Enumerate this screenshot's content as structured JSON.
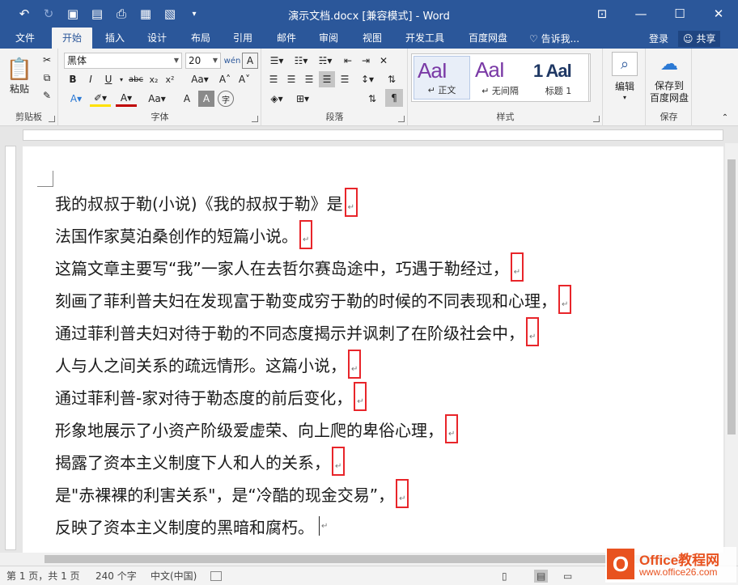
{
  "window": {
    "title": "演示文档.docx [兼容模式] - Word",
    "accent_color": "#2b579a"
  },
  "quick_access": {
    "undo_icon": "undo-icon",
    "redo_icon": "redo-icon",
    "save_icon": "save-icon"
  },
  "tabs": [
    {
      "label": "文件"
    },
    {
      "label": "开始"
    },
    {
      "label": "插入"
    },
    {
      "label": "设计"
    },
    {
      "label": "布局"
    },
    {
      "label": "引用"
    },
    {
      "label": "邮件"
    },
    {
      "label": "审阅"
    },
    {
      "label": "视图"
    },
    {
      "label": "开发工具"
    },
    {
      "label": "百度网盘"
    }
  ],
  "tell_me": "告诉我...",
  "signin": "登录",
  "share": "共享",
  "ribbon": {
    "clipboard": {
      "paste": "粘贴",
      "label": "剪贴板"
    },
    "font": {
      "font_name": "黑体",
      "font_size": "20",
      "label": "字体"
    },
    "paragraph": {
      "label": "段落"
    },
    "styles": {
      "label": "样式",
      "items": [
        {
          "sample": "AaI",
          "name": "↵ 正文"
        },
        {
          "sample": "AaI",
          "name": "↵ 无间隔"
        },
        {
          "sample": "1 Aal",
          "name": "标题 1"
        }
      ]
    },
    "editing": {
      "label": "编辑"
    },
    "save": {
      "button": "保存到\n百度网盘",
      "label": "保存"
    }
  },
  "document": {
    "lines": [
      "我的叔叔于勒(小说)《我的叔叔于勒》是",
      "法国作家莫泊桑创作的短篇小说。",
      "这篇文章主要写“我”一家人在去哲尔赛岛途中，巧遇于勒经过，",
      "刻画了菲利普夫妇在发现富于勒变成穷于勒的时候的不同表现和心理，",
      "通过菲利普夫妇对待于勒的不同态度揭示并讽刺了在阶级社会中，",
      "人与人之间关系的疏远情形。这篇小说，",
      "通过菲利普-家对待于勒态度的前后变化，",
      "形象地展示了小资产阶级爱虚荣、向上爬的卑俗心理，",
      "揭露了资本主义制度下人和人的关系，",
      "是\"赤裸裸的利害关系\"，是“冷酷的现金交易”，",
      "反映了资本主义制度的黑暗和腐朽。"
    ]
  },
  "status": {
    "page": "第 1 页，共 1 页",
    "words": "240 个字",
    "language": "中文(中国)"
  },
  "watermark": {
    "main": "Office教程网",
    "url": "www.office26.com"
  }
}
